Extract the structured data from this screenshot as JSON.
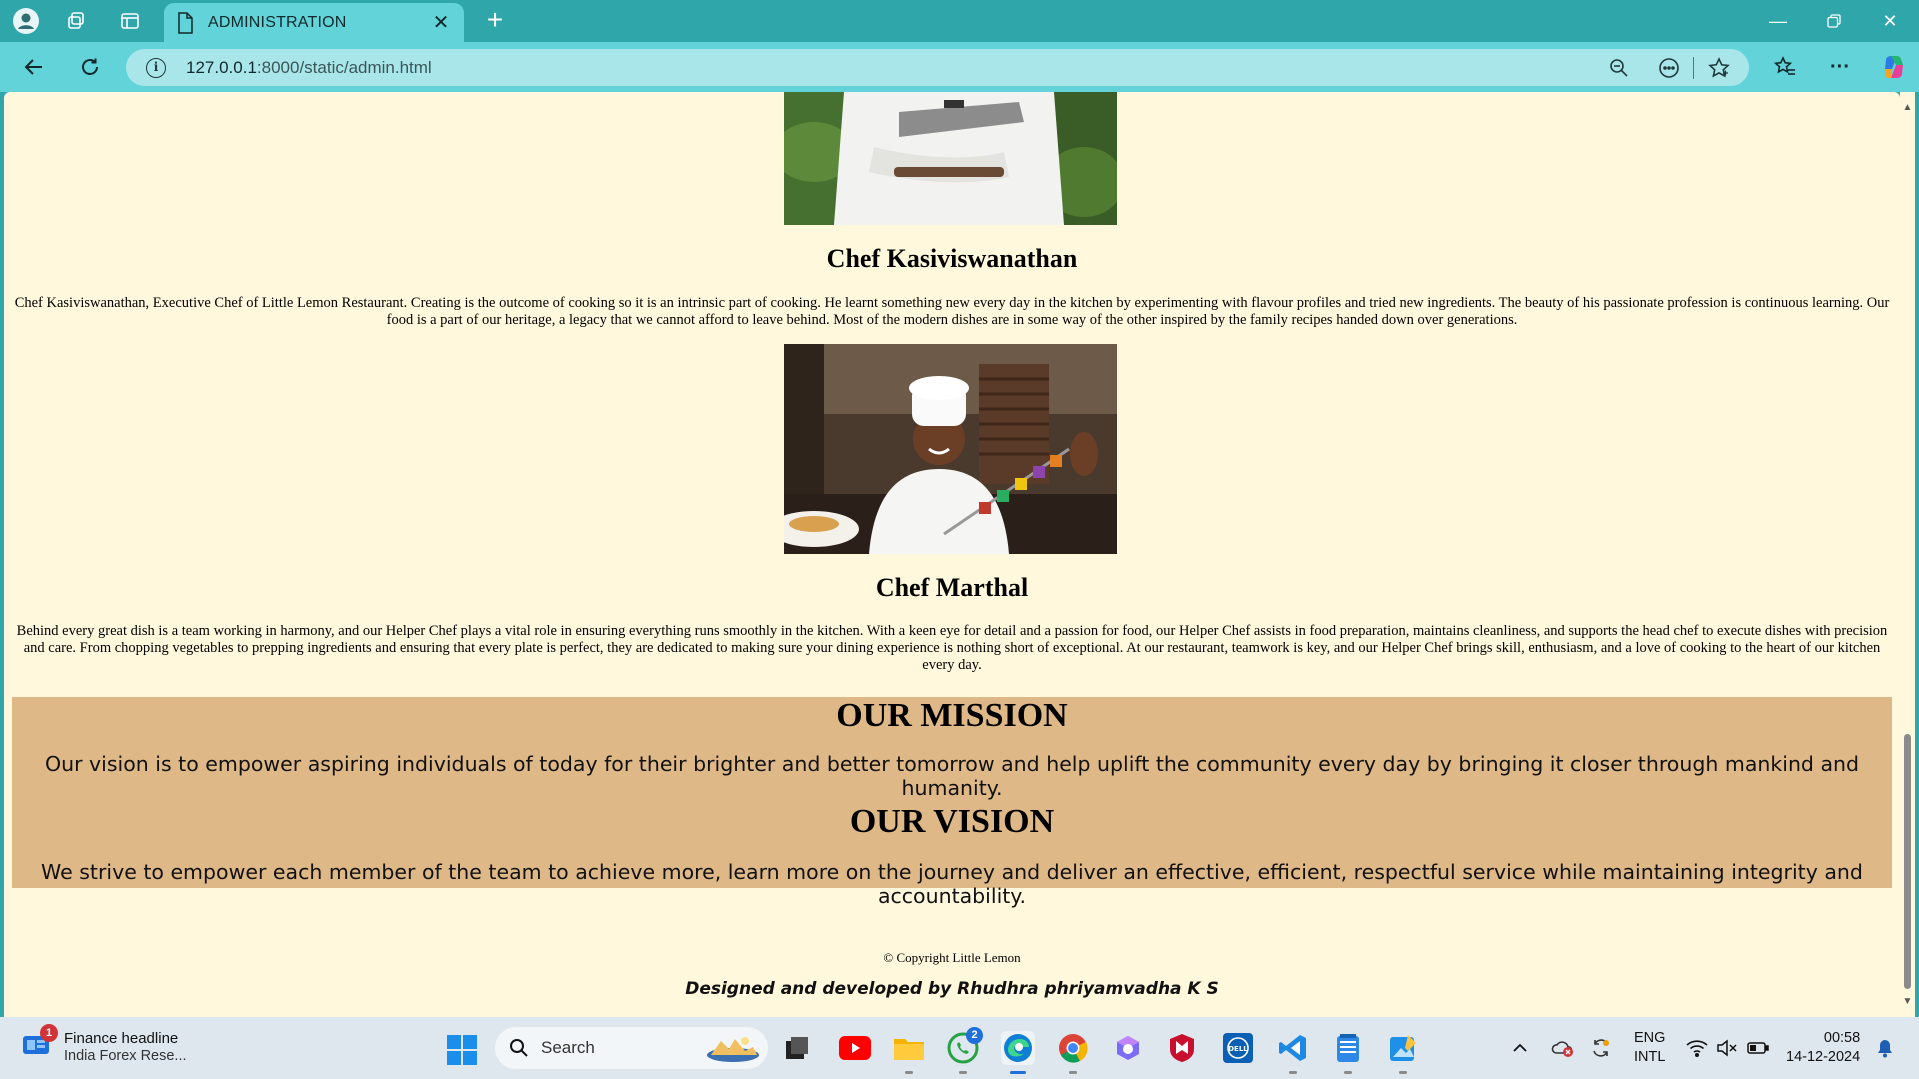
{
  "browser": {
    "tab_title": "ADMINISTRATION",
    "url_host": "127.0.0.1",
    "url_rest": ":8000/static/admin.html"
  },
  "page": {
    "chefs": [
      {
        "name": "Chef Kasiviswanathan",
        "bio": "Chef Kasiviswanathan, Executive Chef of Little Lemon Restaurant. Creating is the outcome of cooking so it is an intrinsic part of cooking. He learnt something new every day in the kitchen by experimenting with flavour profiles and tried new ingredients. The beauty of his passionate profession is continuous learning. Our food is a part of our heritage, a legacy that we cannot afford to leave behind. Most of the modern dishes are in some way of the other inspired by the family recipes handed down over generations."
      },
      {
        "name": "Chef Marthal",
        "bio": "Behind every great dish is a team working in harmony, and our Helper Chef plays a vital role in ensuring everything runs smoothly in the kitchen. With a keen eye for detail and a passion for food, our Helper Chef assists in food preparation, maintains cleanliness, and supports the head chef to execute dishes with precision and care. From chopping vegetables to prepping ingredients and ensuring that every plate is perfect, they are dedicated to making sure your dining experience is nothing short of exceptional. At our restaurant, teamwork is key, and our Helper Chef brings skill, enthusiasm, and a love of cooking to the heart of our kitchen every day."
      }
    ],
    "mission_title": "OUR MISSION",
    "mission_text": "Our vision is to empower aspiring individuals of today for their brighter and better tomorrow and help uplift the community every day by bringing it closer through mankind and humanity.",
    "vision_title": "OUR VISION",
    "vision_text": "We strive to empower each member of the team to achieve more, learn more on the journey and deliver an effective, efficient, respectful service while maintaining integrity and accountability.",
    "copyright": "© Copyright Little Lemon",
    "credits": "Designed and developed by Rhudhra phriyamvadha K S",
    "colors": {
      "background": "#fff8dc",
      "mission_band": "#deb887"
    }
  },
  "taskbar": {
    "news_badge": "1",
    "news_title": "Finance headline",
    "news_subtitle": "India Forex Rese...",
    "search_label": "Search",
    "whatsapp_badge": "2",
    "lang_top": "ENG",
    "lang_bottom": "INTL",
    "time": "00:58",
    "date": "14-12-2024"
  }
}
